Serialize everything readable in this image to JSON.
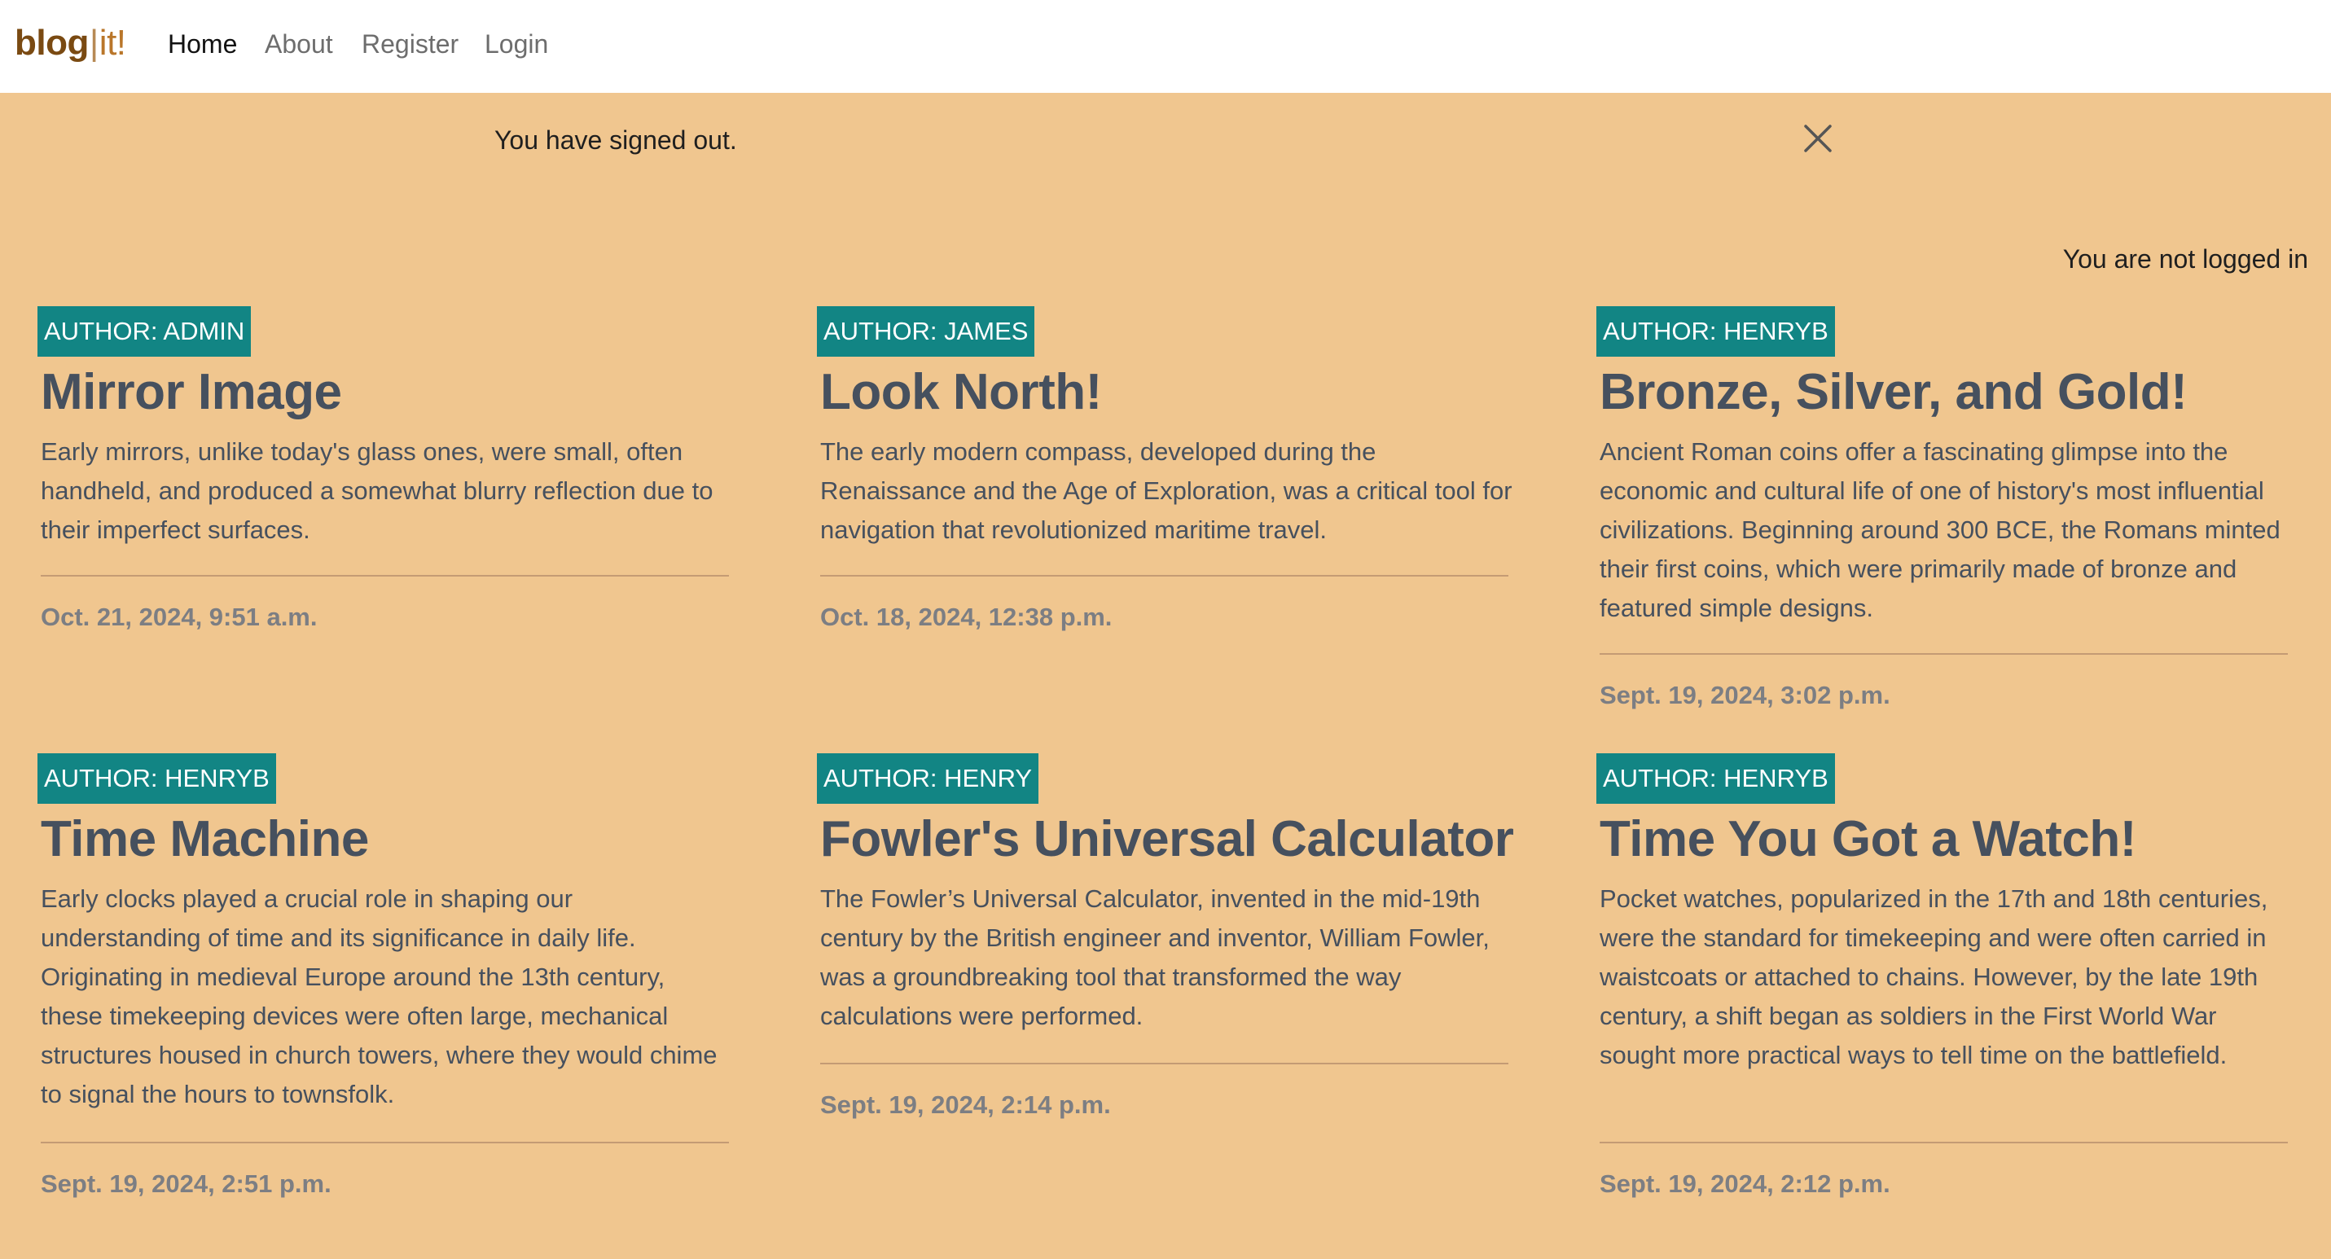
{
  "navbar": {
    "brand_part1": "blog",
    "brand_separator": "|",
    "brand_part2": "it!",
    "links": [
      {
        "label": "Home",
        "active": true
      },
      {
        "label": "About",
        "active": false
      },
      {
        "label": "Register",
        "active": false
      },
      {
        "label": "Login",
        "active": false
      }
    ]
  },
  "alert": {
    "message": "You have signed out.",
    "close_icon": "close-icon"
  },
  "login_status": "You are not logged in",
  "colors": {
    "page_background": "#f0c68f",
    "badge_background": "#128584",
    "title_text": "#46505e",
    "date_text": "#7c7e83"
  },
  "posts": [
    {
      "author": "AUTHOR: ADMIN",
      "title": "Mirror Image",
      "excerpt": "Early mirrors, unlike today's glass ones, were small, often handheld, and produced a somewhat blurry reflection due to their imperfect surfaces.",
      "date": "Oct. 21, 2024, 9:51 a.m."
    },
    {
      "author": "AUTHOR: JAMES",
      "title": "Look North!",
      "excerpt": "The early modern compass, developed during the Renaissance and the Age of Exploration, was a critical tool for navigation that revolutionized maritime travel.",
      "date": "Oct. 18, 2024, 12:38 p.m."
    },
    {
      "author": "AUTHOR: HENRYB",
      "title": "Bronze, Silver, and Gold!",
      "excerpt": "Ancient Roman coins offer a fascinating glimpse into the economic and cultural life of one of history's most influential civilizations. Beginning around 300 BCE, the Romans minted their first coins, which were primarily made of bronze and featured simple designs.",
      "date": "Sept. 19, 2024, 3:02 p.m."
    },
    {
      "author": "AUTHOR: HENRYB",
      "title": "Time Machine",
      "excerpt": "Early clocks played a crucial role in shaping our understanding of time and its significance in daily life. Originating in medieval Europe around the 13th century, these timekeeping devices were often large, mechanical structures housed in church towers, where they would chime to signal the hours to townsfolk.",
      "date": "Sept. 19, 2024, 2:51 p.m."
    },
    {
      "author": "AUTHOR: HENRY",
      "title": "Fowler's Universal Calculator",
      "excerpt": "The Fowler’s Universal Calculator, invented in the mid-19th century by the British engineer and inventor, William Fowler, was a groundbreaking tool that transformed the way calculations were performed.",
      "date": "Sept. 19, 2024, 2:14 p.m."
    },
    {
      "author": "AUTHOR: HENRYB",
      "title": "Time You Got a Watch!",
      "excerpt": "Pocket watches, popularized in the 17th and 18th centuries, were the standard for timekeeping and were often carried in waistcoats or attached to chains. However, by the late 19th century, a shift began as soldiers in the First World War sought more practical ways to tell time on the battlefield.",
      "date": "Sept. 19, 2024, 2:12 p.m."
    }
  ]
}
